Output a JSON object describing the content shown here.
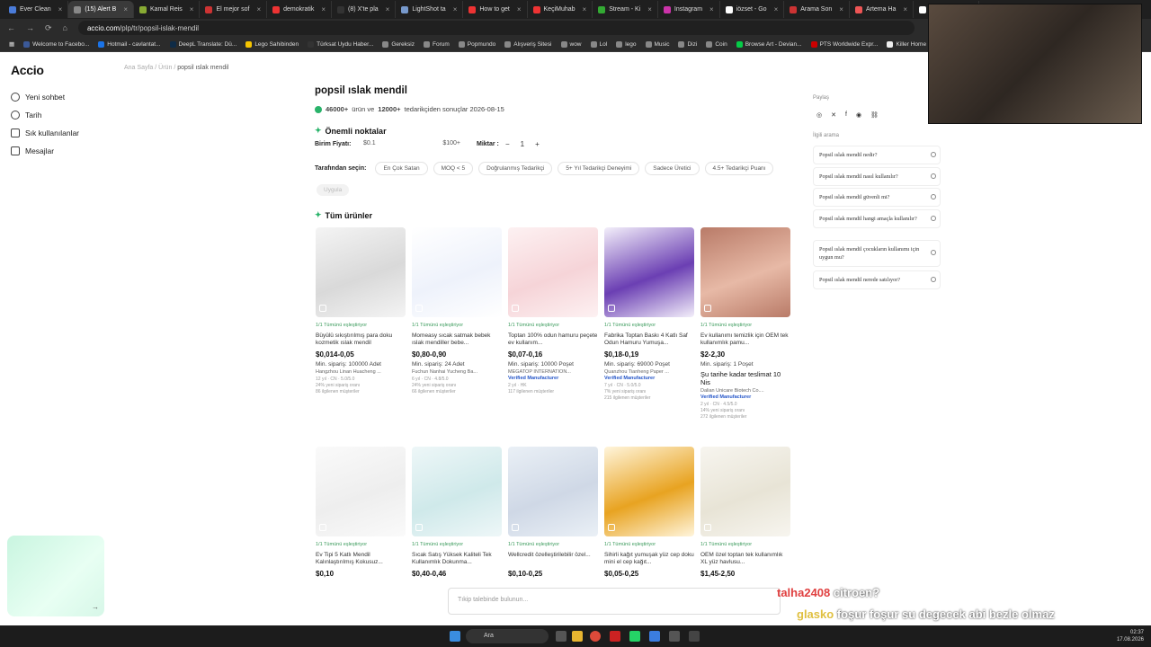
{
  "browser": {
    "tabs": [
      {
        "label": "Ever Clean",
        "color": "#4a7bd8"
      },
      {
        "label": "(15) Alert B",
        "color": "#888"
      },
      {
        "label": "Kamal Reis",
        "color": "#8a3"
      },
      {
        "label": "El mejor sof",
        "color": "#c33"
      },
      {
        "label": "demokratik",
        "color": "#e33"
      },
      {
        "label": "(8) X'te pla",
        "color": "#333"
      },
      {
        "label": "LightShot ta",
        "color": "#79c"
      },
      {
        "label": "How to get",
        "color": "#e33"
      },
      {
        "label": "KeçiMuhab",
        "color": "#e33"
      },
      {
        "label": "Stream - Ki",
        "color": "#3a3"
      },
      {
        "label": "Instagram",
        "color": "#c3a"
      },
      {
        "label": "iözset - Go",
        "color": "#fff"
      },
      {
        "label": "Arama Son",
        "color": "#c33"
      },
      {
        "label": "Artema Ha",
        "color": "#e55"
      },
      {
        "label": "artema mut",
        "color": "#fff"
      }
    ],
    "url_host": "accio.com",
    "url_path": "/plp/tr/popsil-islak-mendil",
    "bookmarks": [
      {
        "label": "Welcome to Facebo...",
        "color": "#3b5998"
      },
      {
        "label": "Hotmail - cavlantat...",
        "color": "#1a73e8"
      },
      {
        "label": "DeepL Translate: Dü...",
        "color": "#0f2b46"
      },
      {
        "label": "Lego Sahibinden",
        "color": "#f5c400"
      },
      {
        "label": "Türksat Uydu Haber...",
        "color": "#333"
      },
      {
        "label": "Gereksiz",
        "color": "#888"
      },
      {
        "label": "Forum",
        "color": "#888"
      },
      {
        "label": "Popmundo",
        "color": "#888"
      },
      {
        "label": "Alışveriş Sitesi",
        "color": "#888"
      },
      {
        "label": "wow",
        "color": "#888"
      },
      {
        "label": "Lol",
        "color": "#888"
      },
      {
        "label": "lego",
        "color": "#888"
      },
      {
        "label": "Music",
        "color": "#888"
      },
      {
        "label": "Dizi",
        "color": "#888"
      },
      {
        "label": "Coin",
        "color": "#888"
      },
      {
        "label": "Browse Art - Devian...",
        "color": "#05cc47"
      },
      {
        "label": "PTS Worldwide Expr...",
        "color": "#c00"
      },
      {
        "label": "Killer Home Chest...",
        "color": "#eee"
      }
    ]
  },
  "sidebar": {
    "logo": "Accio",
    "items": [
      {
        "label": "Yeni sohbet",
        "icon": "plus-chat-icon"
      },
      {
        "label": "Tarih",
        "icon": "clock-icon"
      },
      {
        "label": "Sık kullanılanlar",
        "icon": "heart-icon"
      },
      {
        "label": "Mesajlar",
        "icon": "message-icon"
      }
    ]
  },
  "breadcrumb": {
    "home": "Ana Sayfa",
    "sep": "/",
    "cat": "Ürün",
    "current": "popsil ıslak mendil"
  },
  "main": {
    "title": "popsil ıslak mendil",
    "results_count": "46000+",
    "results_mid": "ürün ve",
    "suppliers_count": "12000+",
    "results_tail": "tedarikçiden sonuçlar 2026-08-15",
    "highlights": "Önemli noktalar",
    "unit_price_label": "Birim Fiyatı:",
    "price_min": "$0.1",
    "price_max": "$100+",
    "qty_label": "Miktar :",
    "qty_minus": "−",
    "qty_value": "1",
    "qty_plus": "+",
    "select_by": "Tarafından seçin:",
    "filters": [
      "En Çok Satan",
      "MOQ < 5",
      "Doğrulanmış Tedarikçi",
      "5+ Yıl Tedarikçi Deneyimi",
      "Sadece Üretici",
      "4.5+ Tedarikçi Puanı"
    ],
    "apply": "Uygula",
    "all_products": "Tüm ürünler"
  },
  "products": [
    {
      "match": "1/1 Tümünü eşleştiriyor",
      "name": "Büyülü sıkıştırılmış para doku kozmetik ıslak mendil",
      "price": "$0,014-0,05",
      "moq": "Min. sipariş: 100000 Adet",
      "supplier": "Hangzhou Linan Huacheng ...",
      "verified": "",
      "meta": "12 yıl · CN · 5.0/5.0",
      "meta2": "24% yeni sipariş oranı",
      "meta3": "86 ilgilenen müşteriler",
      "c1": "#d9d9d9",
      "c2": "#f4f4f4"
    },
    {
      "match": "1/1 Tümünü eşleştiriyor",
      "name": "Momeasy sıcak satmak bebek ıslak mendiller bebe...",
      "price": "$0,80-0,90",
      "moq": "Min. sipariş: 24 Adet",
      "supplier": "Fuchun Nanhai Yucheng Ba...",
      "verified": "",
      "meta": "6 yıl · CN · 4.8/5.0",
      "meta2": "24% yeni sipariş oranı",
      "meta3": "66 ilgilenen müşteriler",
      "c1": "#eef2fb",
      "c2": "#ffffff"
    },
    {
      "match": "1/1 Tümünü eşleştiriyor",
      "name": "Toptan 100% odun hamuru peçete ev kullanım...",
      "price": "$0,07-0,16",
      "moq": "Min. sipariş: 10000 Poşet",
      "supplier": "MEGATOP INTERNATION...",
      "verified": "Verified Manufacturer",
      "meta": "2 yıl · HK",
      "meta2": "117 ilgilenen müşteriler",
      "meta3": "",
      "c1": "#f6d4d8",
      "c2": "#fdf1f2"
    },
    {
      "match": "1/1 Tümünü eşleştiriyor",
      "name": "Fabrika Toptan Baskı 4 Katlı Saf Odun Hamuru Yumuşa...",
      "price": "$0,18-0,19",
      "moq": "Min. sipariş: 69000 Poşet",
      "supplier": "Quanzhou Tianheng Paper ...",
      "verified": "Verified Manufacturer",
      "meta": "7 yıl · CN · 5.0/5.0",
      "meta2": "7% yeni sipariş oranı",
      "meta3": "215 ilgilenen müşteriler",
      "c1": "#6b3fb3",
      "c2": "#f3effa"
    },
    {
      "match": "1/1 Tümünü eşleştiriyor",
      "name": "Ev kullanımı temizlik için OEM tek kullanımlık pamu...",
      "price": "$2-2,30",
      "moq": "Min. sipariş: 1 Poşet",
      "supplier": "Dalian Unicare Biotech Co....",
      "verified": "Verified Manufacturer",
      "meta": "2 yıl · CN · 4.5/5.0",
      "meta2": "14% yeni sipariş oranı",
      "meta3": "272 ilgilenen müşteriler",
      "c1": "#e7b9a6",
      "c2": "#b97b68",
      "extra": "Şu tarihe kadar teslimat 10 Nis"
    },
    {
      "match": "1/1 Tümünü eşleştiriyor",
      "name": "Ev Tipi 5 Katlı Mendil Kalınlaştırılmış Kokusuz...",
      "price": "$0,10",
      "c1": "#eeeeee",
      "c2": "#fafafa"
    },
    {
      "match": "1/1 Tümünü eşleştiriyor",
      "name": "Sıcak Satış Yüksek Kaliteli Tek Kullanımlık Dokunma...",
      "price": "$0,40-0,46",
      "c1": "#cfe9ea",
      "c2": "#eef7f8"
    },
    {
      "match": "1/1 Tümünü eşleştiriyor",
      "name": "Wellcredit özelleştirilebilir özel...",
      "price": "$0,10-0,25",
      "c1": "#cfd8e6",
      "c2": "#eaf0f6"
    },
    {
      "match": "1/1 Tümünü eşleştiriyor",
      "name": "Sihirli kağıt yumuşak yüz cep doku mini el cep kağıt...",
      "price": "$0,05-0,25",
      "c1": "#e8a321",
      "c2": "#fff5dc"
    },
    {
      "match": "1/1 Tümünü eşleştiriyor",
      "name": "OEM özel toptan tek kullanımlık XL yüz havlusu...",
      "price": "$1,45-2,50",
      "c1": "#e8e4d6",
      "c2": "#f7f5ef"
    }
  ],
  "right": {
    "share": "Paylaş",
    "related": "İlgili arama",
    "questions": [
      "Popsil ıslak mendil nedir?",
      "Popsil ıslak mendil nasıl kullanılır?",
      "Popsil ıslak mendil güvenli mi?",
      "Popsil ıslak mendil hangi amaçla kullanılır?",
      "Popsil ıslak mendil çocukların kullanımı için uygun mu?",
      "Popsil ıslak mendil nerede satılıyor?"
    ]
  },
  "bottom_search": {
    "placeholder": "Tıkip talebinde bulunun..."
  },
  "chat": [
    {
      "user": "talha2408",
      "msg": "citroen?"
    },
    {
      "user": "glasko",
      "msg": "foşur foşur su degecek abi bezle olmaz"
    }
  ],
  "taskbar": {
    "search": "Ara",
    "time": "02:37",
    "date": "17.08.2026"
  }
}
